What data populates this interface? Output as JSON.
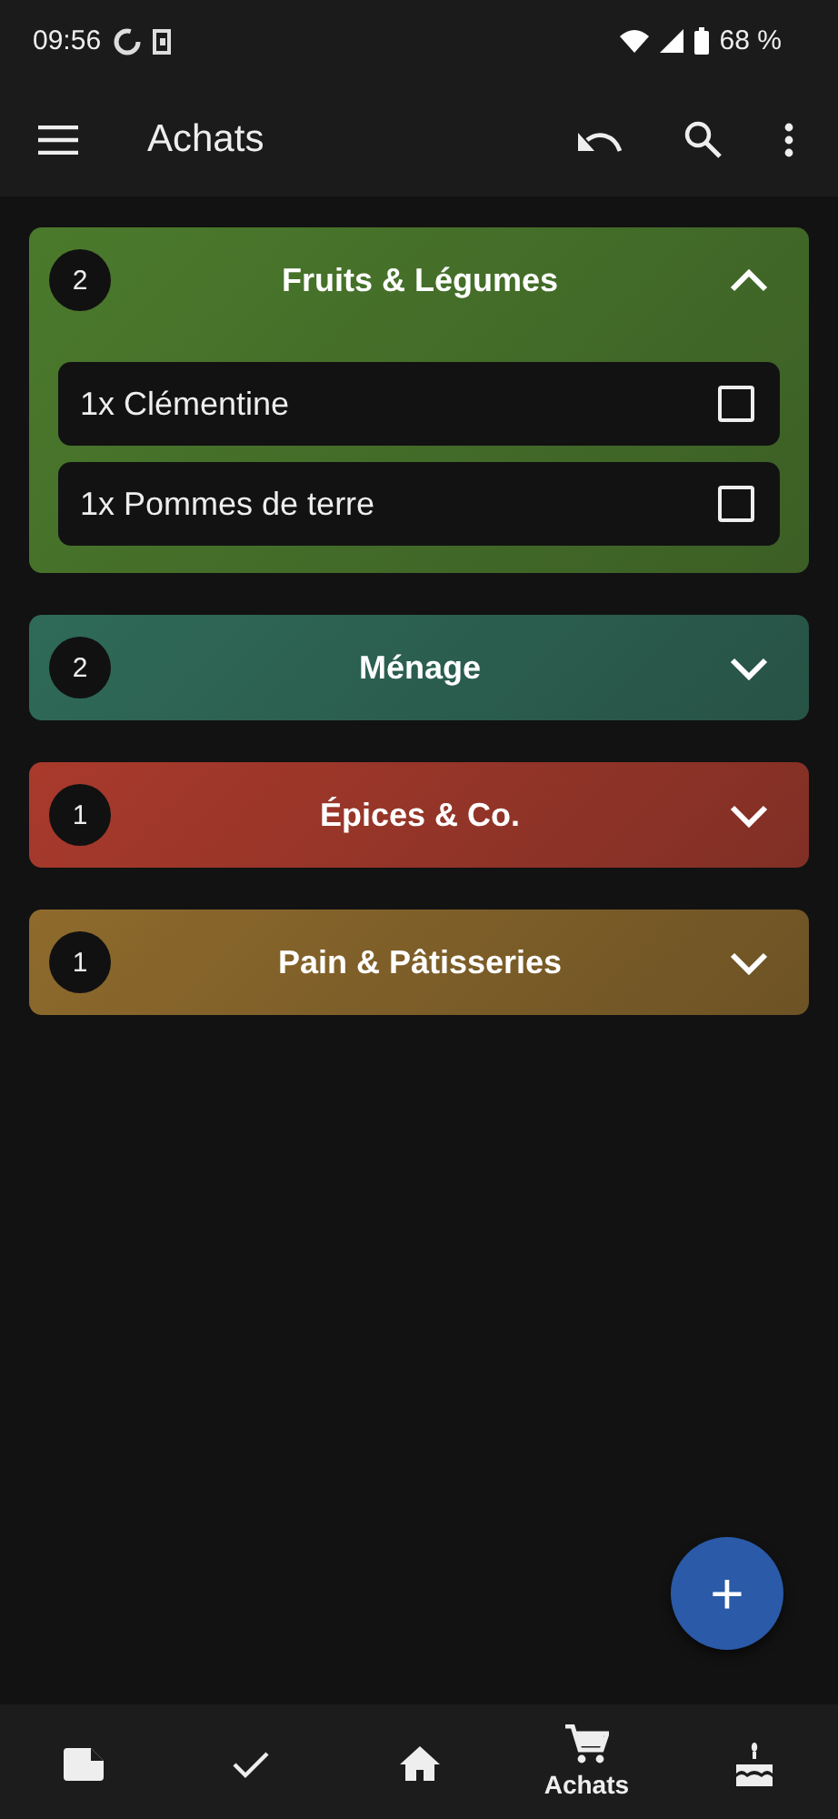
{
  "status_bar": {
    "time": "09:56",
    "battery": "68 %"
  },
  "toolbar": {
    "title": "Achats"
  },
  "categories": [
    {
      "name": "Fruits & Légumes",
      "count": "2",
      "color": "#4b7a2c",
      "expanded": true,
      "items": [
        {
          "label": "1x Clémentine",
          "checked": false
        },
        {
          "label": "1x Pommes de terre",
          "checked": false
        }
      ]
    },
    {
      "name": "Ménage",
      "count": "2",
      "color": "#2f6a58",
      "expanded": false
    },
    {
      "name": "Épices & Co.",
      "count": "1",
      "color": "#a93a2c",
      "expanded": false
    },
    {
      "name": "Pain & Pâtisseries",
      "count": "1",
      "color": "#8e6a2c",
      "expanded": false
    }
  ],
  "fab": {
    "label": "+"
  },
  "bottom_nav": [
    {
      "kind": "notes",
      "selected": false
    },
    {
      "kind": "tasks",
      "selected": false
    },
    {
      "kind": "home",
      "selected": false
    },
    {
      "kind": "cart",
      "label": "Achats",
      "selected": true
    },
    {
      "kind": "cake",
      "selected": false
    }
  ]
}
